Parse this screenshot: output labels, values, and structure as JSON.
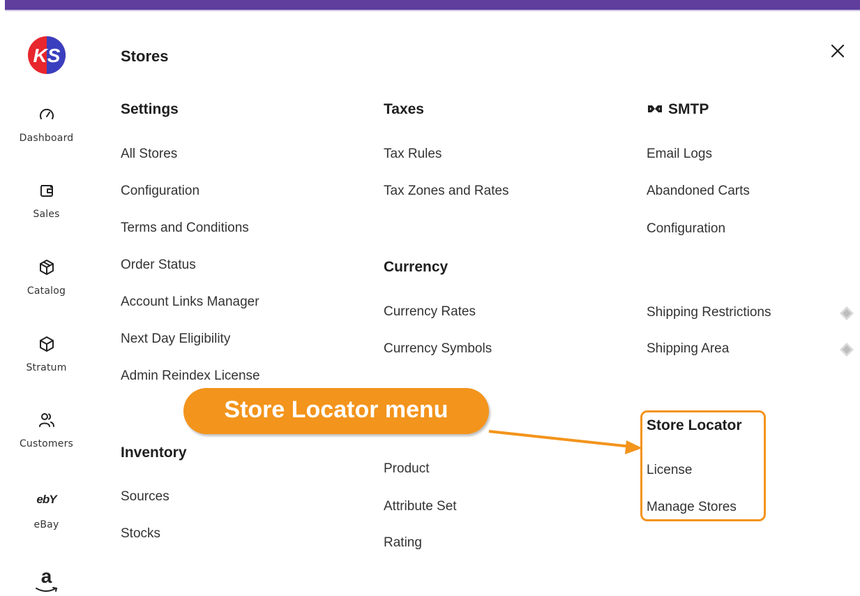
{
  "sidebar": {
    "logo_text": "KS",
    "items": [
      {
        "label": "Dashboard",
        "icon": "gauge-icon"
      },
      {
        "label": "Sales",
        "icon": "wallet-icon"
      },
      {
        "label": "Catalog",
        "icon": "box-icon"
      },
      {
        "label": "Stratum",
        "icon": "cube-icon"
      },
      {
        "label": "Customers",
        "icon": "users-icon"
      },
      {
        "label": "eBay",
        "icon": "ebay-icon",
        "icon_text": "ebY"
      },
      {
        "label": "",
        "icon": "amazon-icon",
        "icon_text": "a"
      }
    ]
  },
  "panel": {
    "title": "Stores",
    "close_icon": "close-icon"
  },
  "columns": {
    "settings": {
      "heading": "Settings",
      "links": [
        "All Stores",
        "Configuration",
        "Terms and Conditions",
        "Order Status",
        "Account Links Manager",
        "Next Day Eligibility",
        "Admin Reindex License"
      ]
    },
    "inventory": {
      "heading": "Inventory",
      "links": [
        "Sources",
        "Stocks"
      ]
    },
    "taxes": {
      "heading": "Taxes",
      "links": [
        "Tax Rules",
        "Tax Zones and Rates"
      ]
    },
    "currency": {
      "heading": "Currency",
      "links": [
        "Currency Rates",
        "Currency Symbols"
      ]
    },
    "attributes": {
      "links": [
        "Product",
        "Attribute Set",
        "Rating"
      ]
    },
    "smtp": {
      "heading": "SMTP",
      "icon": "smtp-icon",
      "links": [
        "Email Logs",
        "Abandoned Carts",
        "Configuration"
      ]
    },
    "shipping": {
      "links": [
        "Shipping Restrictions",
        "Shipping Area"
      ],
      "icon": "diamond-icon"
    },
    "store_locator": {
      "heading": "Store Locator",
      "links": [
        "License",
        "Manage Stores"
      ]
    }
  },
  "annotation": {
    "callout_text": "Store Locator menu",
    "color": "#f3941c"
  },
  "colors": {
    "topbar": "#5f3e9e",
    "accent": "#f3941c"
  }
}
